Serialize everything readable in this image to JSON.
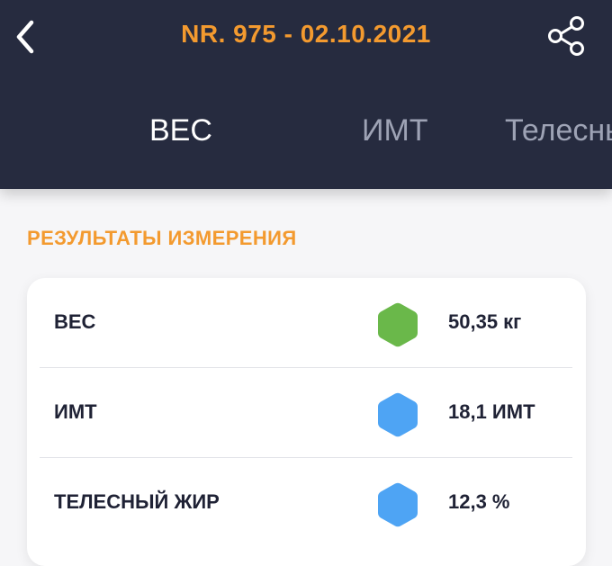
{
  "header": {
    "title": "NR. 975 - 02.10.2021",
    "back_icon": "chevron-left-icon",
    "share_icon": "share-icon",
    "background": "#262b3f",
    "accent": "#f39a2f"
  },
  "tabs": [
    {
      "label": "ВЕС",
      "active": true
    },
    {
      "label": "ИМТ",
      "active": false
    },
    {
      "label": "Телесный жир",
      "active": false
    }
  ],
  "section": {
    "title": "РЕЗУЛЬТАТЫ ИЗМЕРЕНИЯ"
  },
  "results": [
    {
      "label": "ВЕС",
      "value": "50,35 кг",
      "indicator_color": "#6ab84a",
      "indicator_icon": "hexagon-icon"
    },
    {
      "label": "ИМТ",
      "value": "18,1 ИМТ",
      "indicator_color": "#4ea4f4",
      "indicator_icon": "hexagon-icon"
    },
    {
      "label": "ТЕЛЕСНЫЙ ЖИР",
      "value": "12,3 %",
      "indicator_color": "#4ea4f4",
      "indicator_icon": "hexagon-icon"
    }
  ]
}
